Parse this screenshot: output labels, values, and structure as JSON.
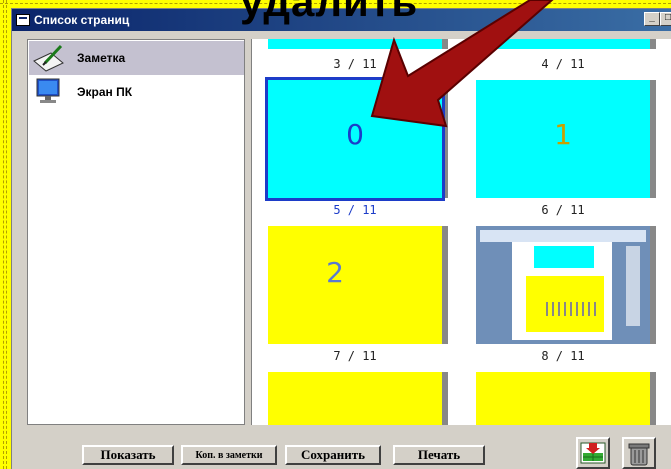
{
  "overlay": {
    "text": "удалить"
  },
  "window": {
    "title": "Список страниц",
    "title_buttons": [
      "_",
      "□"
    ]
  },
  "sidebar": {
    "items": [
      {
        "label": "Заметка",
        "icon": "pen-note-icon",
        "selected": true
      },
      {
        "label": "Экран ПК",
        "icon": "pc-screen-icon",
        "selected": false
      }
    ]
  },
  "pages": {
    "items": [
      {
        "label": "3 / 11",
        "color": "#00ffff",
        "glyph": ""
      },
      {
        "label": "4 / 11",
        "color": "#00ffff",
        "glyph": ""
      },
      {
        "label": "5 / 11",
        "color": "#00ffff",
        "glyph": "0",
        "selected": true
      },
      {
        "label": "6 / 11",
        "color": "#00ffff",
        "glyph": "1"
      },
      {
        "label": "7 / 11",
        "color": "#ffff00",
        "glyph": "2"
      },
      {
        "label": "8 / 11",
        "color": "#ffffff",
        "glyph": ""
      },
      {
        "label": "",
        "color": "#ffff00",
        "glyph": ""
      },
      {
        "label": "",
        "color": "#ffff00",
        "glyph": ""
      }
    ]
  },
  "toolbar": {
    "show_label": "Показать",
    "copy_label": "Коп. в заметки",
    "save_label": "Сохранить",
    "print_label": "Печать"
  },
  "colors": {
    "accent": "#1c3cc8",
    "arrow": "#a01010",
    "slide_background": "#ffff00"
  }
}
